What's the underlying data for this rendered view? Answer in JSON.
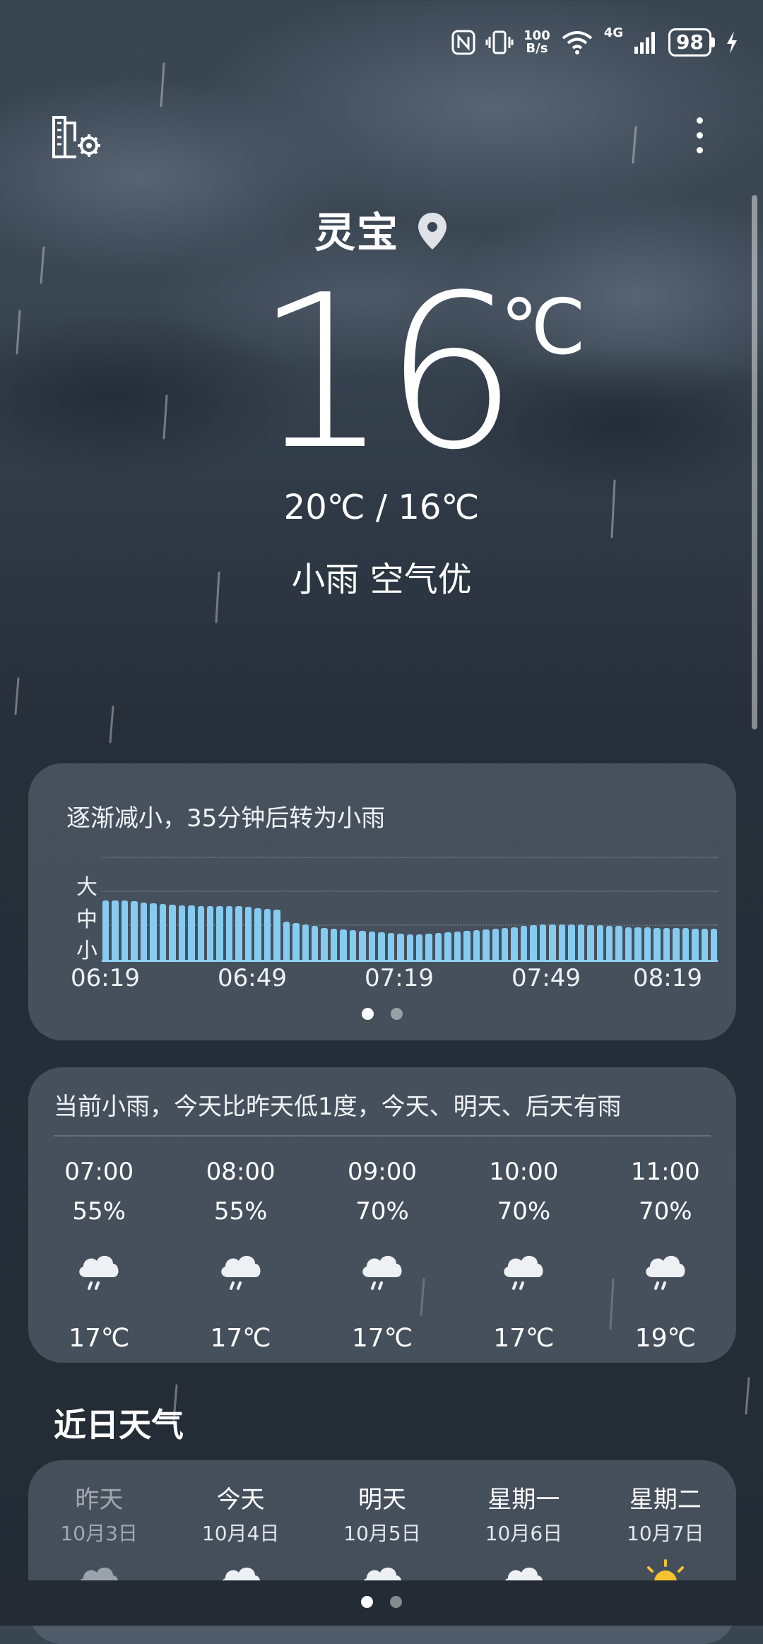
{
  "status_bar": {
    "net_speed_value": "100",
    "net_speed_unit": "B/s",
    "network_type": "4G",
    "battery": "98",
    "icons": [
      "nfc-icon",
      "vibrate-icon",
      "wifi-icon",
      "signal-icon",
      "charging-icon"
    ]
  },
  "header": {
    "city": "灵宝",
    "temperature": "16",
    "temperature_unit": "℃",
    "temp_range": "20℃ / 16℃",
    "condition": "小雨  空气优"
  },
  "precipitation": {
    "title": "逐渐减小，35分钟后转为小雨",
    "levels": [
      "大",
      "中",
      "小"
    ],
    "time_labels": [
      "06:19",
      "06:49",
      "07:19",
      "07:49",
      "08:19"
    ],
    "intensity": [
      0.78,
      0.78,
      0.78,
      0.77,
      0.75,
      0.74,
      0.73,
      0.72,
      0.71,
      0.71,
      0.7,
      0.7,
      0.7,
      0.7,
      0.7,
      0.69,
      0.68,
      0.67,
      0.66,
      0.5,
      0.48,
      0.46,
      0.44,
      0.42,
      0.41,
      0.4,
      0.39,
      0.38,
      0.37,
      0.36,
      0.35,
      0.34,
      0.33,
      0.33,
      0.34,
      0.35,
      0.36,
      0.37,
      0.38,
      0.39,
      0.4,
      0.41,
      0.42,
      0.43,
      0.44,
      0.45,
      0.46,
      0.46,
      0.46,
      0.46,
      0.46,
      0.45,
      0.45,
      0.44,
      0.44,
      0.43,
      0.43,
      0.43,
      0.42,
      0.42,
      0.42,
      0.42,
      0.41,
      0.41,
      0.41
    ],
    "page_dots": 2,
    "active_dot": 0
  },
  "hourly": {
    "summary": "当前小雨，今天比昨天低1度，今天、明天、后天有雨",
    "items": [
      {
        "time": "07:00",
        "precip": "55%",
        "temp": "17℃",
        "icon": "light-rain-icon"
      },
      {
        "time": "08:00",
        "precip": "55%",
        "temp": "17℃",
        "icon": "light-rain-icon"
      },
      {
        "time": "09:00",
        "precip": "70%",
        "temp": "17℃",
        "icon": "light-rain-icon"
      },
      {
        "time": "10:00",
        "precip": "70%",
        "temp": "17℃",
        "icon": "light-rain-icon"
      },
      {
        "time": "11:00",
        "precip": "70%",
        "temp": "19℃",
        "icon": "light-rain-icon"
      }
    ]
  },
  "daily": {
    "title": "近日天气",
    "items": [
      {
        "name": "昨天",
        "date": "10月3日",
        "icon": "partly-cloudy-icon"
      },
      {
        "name": "今天",
        "date": "10月4日",
        "icon": "rain-cloud-icon"
      },
      {
        "name": "明天",
        "date": "10月5日",
        "icon": "rain-cloud-icon"
      },
      {
        "name": "星期一",
        "date": "10月6日",
        "icon": "rain-cloud-icon"
      },
      {
        "name": "星期二",
        "date": "10月7日",
        "icon": "sunny-icon"
      }
    ]
  },
  "pager": {
    "dots": 2,
    "active": 0
  },
  "colors": {
    "bar": "#86ccf0",
    "card": "#56626e",
    "background": "#262e39"
  }
}
